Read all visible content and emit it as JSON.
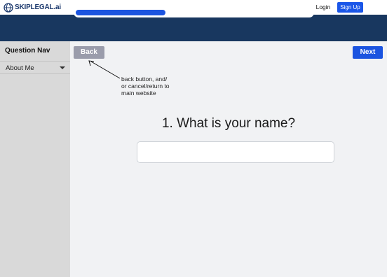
{
  "header": {
    "logo_text": "SKIPLEGAL.ai",
    "login_label": "Login",
    "signup_label": "Sign Up"
  },
  "progress": {
    "fraction": 0.38
  },
  "sidebar": {
    "title": "Question Nav",
    "items": [
      {
        "label": "About Me"
      }
    ]
  },
  "buttons": {
    "back_label": "Back",
    "next_label": "Next"
  },
  "annotation": {
    "lines": [
      "back button, and/",
      "or cancel/return to",
      "main website"
    ]
  },
  "question": {
    "text": "1. What is your name?",
    "answer_value": "",
    "answer_placeholder": ""
  },
  "colors": {
    "brand_navy": "#18375f",
    "accent_blue": "#1b54e0",
    "back_gray": "#9a9cab",
    "sidebar_gray": "#d9d9d9",
    "page_bg": "#f1f2f4"
  }
}
